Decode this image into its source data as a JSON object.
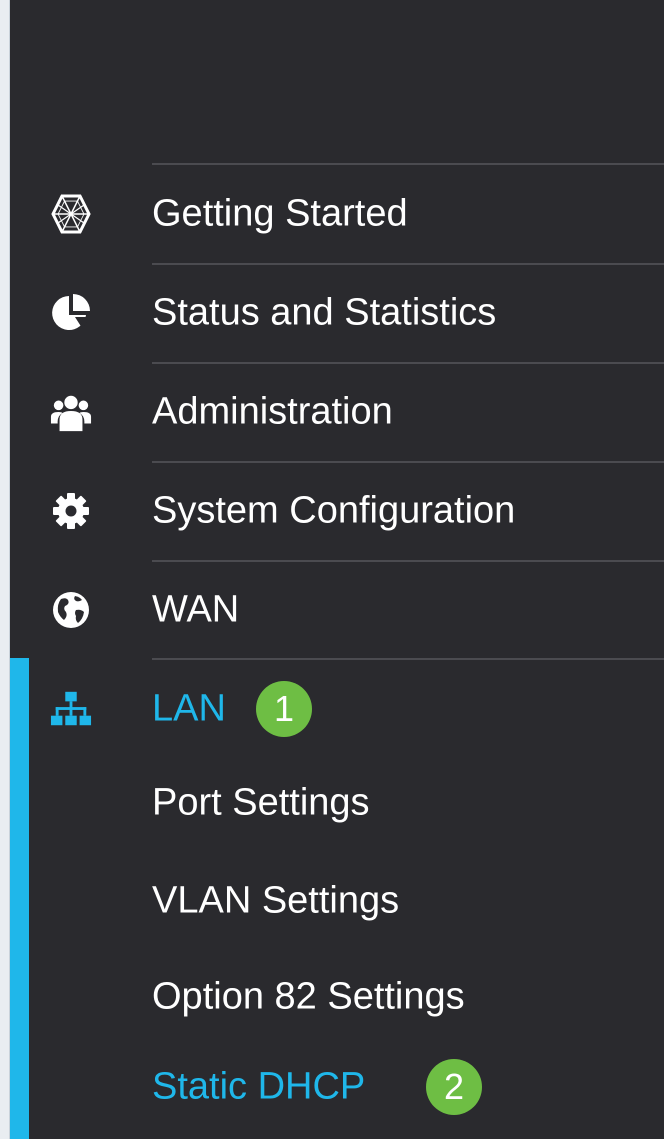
{
  "colors": {
    "background": "#2a2a2e",
    "active": "#1fb7ea",
    "badge": "#6ebe44",
    "text": "#ffffff"
  },
  "nav": {
    "items": [
      {
        "label": "Getting Started",
        "icon": "hexagon-globe-icon"
      },
      {
        "label": "Status and Statistics",
        "icon": "pie-chart-icon"
      },
      {
        "label": "Administration",
        "icon": "users-icon"
      },
      {
        "label": "System Configuration",
        "icon": "gear-icon"
      },
      {
        "label": "WAN",
        "icon": "globe-icon"
      },
      {
        "label": "LAN",
        "icon": "network-icon",
        "active": true,
        "badge": "1"
      }
    ],
    "lan_subitems": [
      {
        "label": "Port Settings"
      },
      {
        "label": "VLAN Settings"
      },
      {
        "label": "Option 82 Settings"
      },
      {
        "label": "Static DHCP",
        "active": true,
        "badge": "2"
      }
    ]
  }
}
